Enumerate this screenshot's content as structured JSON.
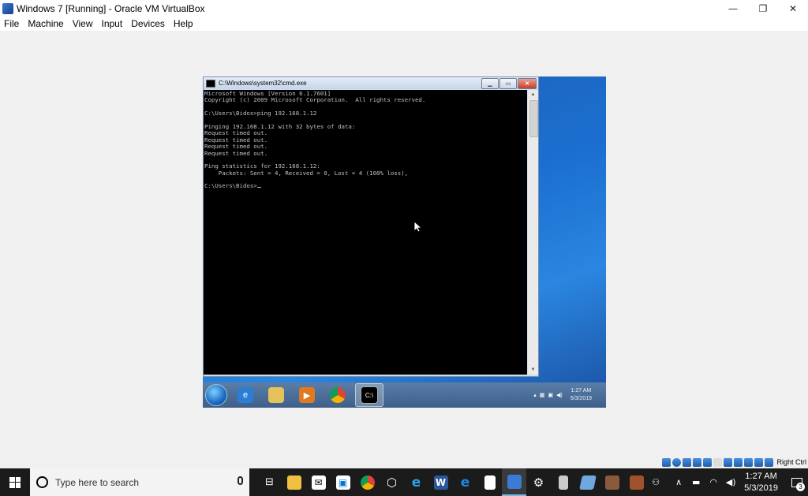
{
  "window": {
    "title": "Windows 7 [Running] - Oracle VM VirtualBox",
    "minimize": "—",
    "restore": "❐",
    "close": "✕"
  },
  "menu": [
    "File",
    "Machine",
    "View",
    "Input",
    "Devices",
    "Help"
  ],
  "cmd": {
    "title": "C:\\Windows\\system32\\cmd.exe",
    "lines": [
      "Microsoft Windows [Version 6.1.7601]",
      "Copyright (c) 2009 Microsoft Corporation.  All rights reserved.",
      "",
      "C:\\Users\\Bidos>ping 192.168.1.12",
      "",
      "Pinging 192.168.1.12 with 32 bytes of data:",
      "Request timed out.",
      "Request timed out.",
      "Request timed out.",
      "Request timed out.",
      "",
      "Ping statistics for 192.168.1.12:",
      "    Packets: Sent = 4, Received = 0, Lost = 4 (100% loss),",
      "",
      "C:\\Users\\Bidos>"
    ]
  },
  "vm_taskbar": {
    "clock_time": "1:27 AM",
    "clock_date": "5/3/2019"
  },
  "statusbar": {
    "host_key": "Right Ctrl"
  },
  "host_taskbar": {
    "search_placeholder": "Type here to search",
    "clock_time": "1:27 AM",
    "clock_date": "5/3/2019",
    "notification_count": "3"
  }
}
